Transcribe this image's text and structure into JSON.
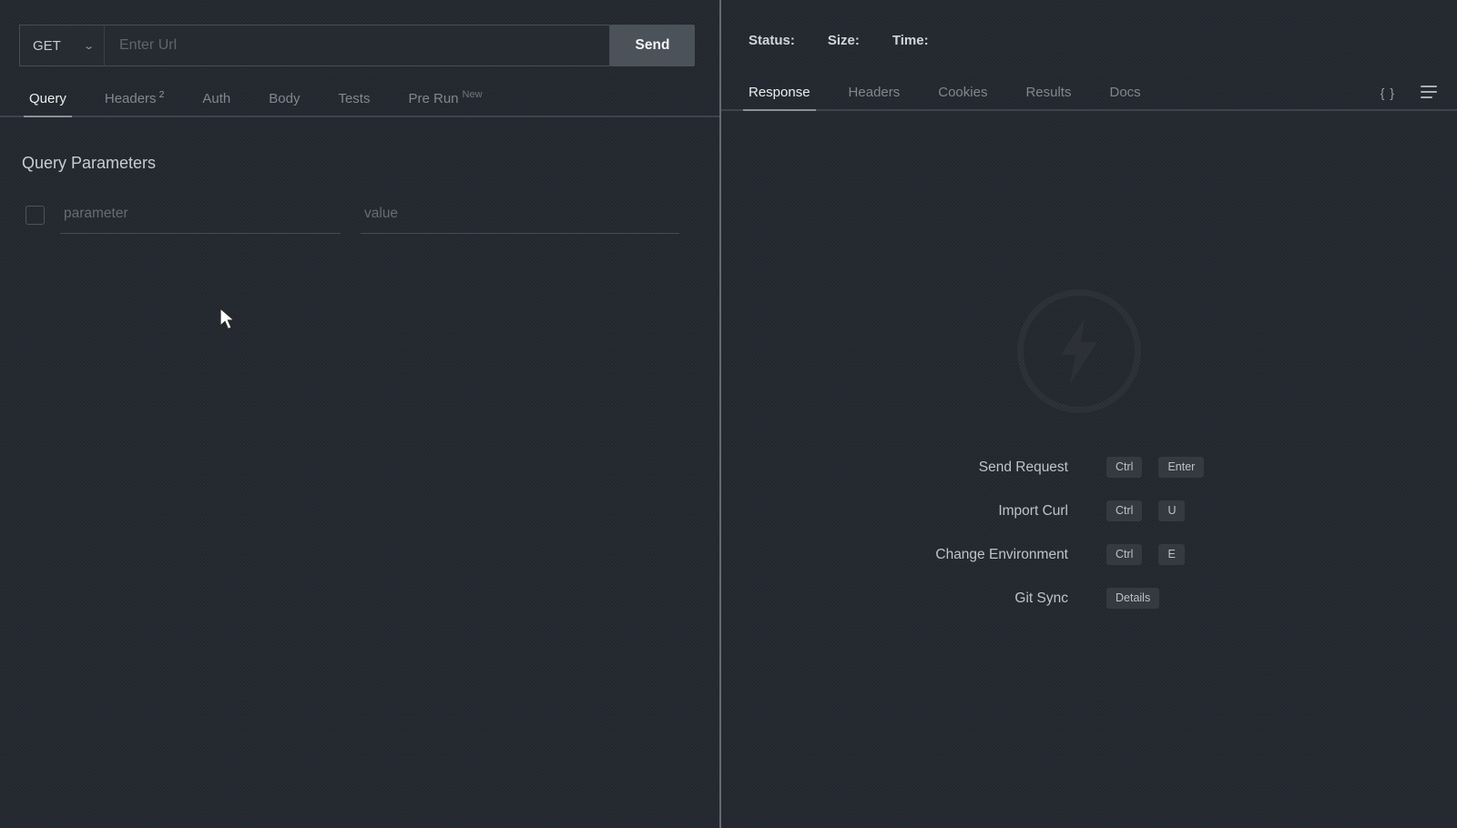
{
  "request": {
    "method": "GET",
    "url_value": "",
    "url_placeholder": "Enter Url",
    "send_label": "Send"
  },
  "request_tabs": [
    {
      "label": "Query",
      "active": true
    },
    {
      "label": "Headers",
      "badge": "2"
    },
    {
      "label": "Auth"
    },
    {
      "label": "Body"
    },
    {
      "label": "Tests"
    },
    {
      "label": "Pre Run",
      "badge": "New"
    }
  ],
  "query_params": {
    "heading": "Query Parameters",
    "parameter_placeholder": "parameter",
    "value_placeholder": "value"
  },
  "response_meta": {
    "status_label": "Status:",
    "size_label": "Size:",
    "time_label": "Time:"
  },
  "response_tabs": [
    {
      "label": "Response",
      "active": true
    },
    {
      "label": "Headers"
    },
    {
      "label": "Cookies"
    },
    {
      "label": "Results"
    },
    {
      "label": "Docs"
    }
  ],
  "icons": {
    "braces_label": "{ }",
    "menu": "menu-lines",
    "method_chevron": "⌄",
    "thunder_logo": "lightning-bolt-circle"
  },
  "shortcuts": [
    {
      "label": "Send Request",
      "key1": "Ctrl",
      "key2": "Enter"
    },
    {
      "label": "Import Curl",
      "key1": "Ctrl",
      "key2": "U"
    },
    {
      "label": "Change Environment",
      "key1": "Ctrl",
      "key2": "E"
    },
    {
      "label": "Git Sync",
      "key1": "Details",
      "key2": ""
    }
  ],
  "colors": {
    "background": "#23272e",
    "panel_divider": "#666b70",
    "active_tab_text": "#eceef0",
    "inactive_tab_text": "#81878e",
    "send_button_bg": "#4c5259",
    "key_badge_bg": "#353a41",
    "input_underline": "#47495c"
  }
}
